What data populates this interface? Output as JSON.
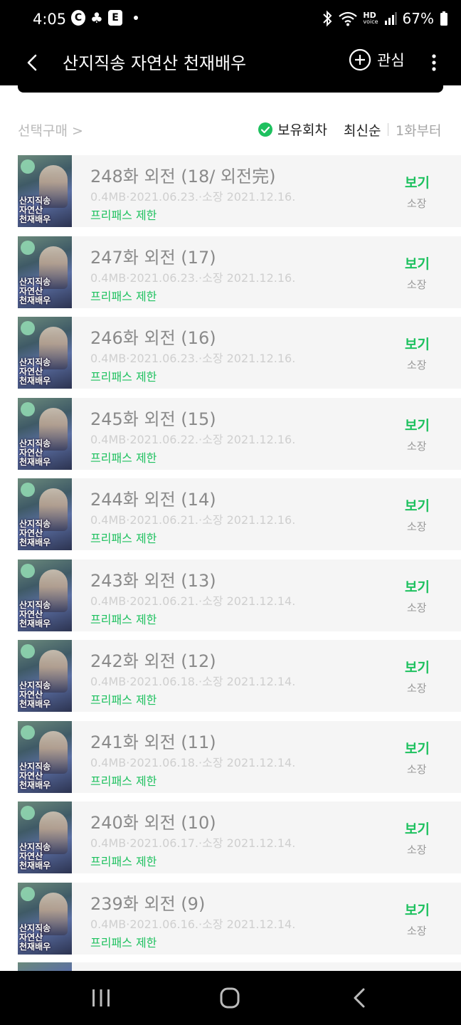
{
  "status_bar": {
    "time": "4:05",
    "notif_icons": [
      "C",
      "♣",
      "E"
    ],
    "icons": [
      "bluetooth-icon",
      "wifi-icon",
      "hd-voice-icon",
      "signal-icon",
      "battery-icon"
    ],
    "hd_label": "HD",
    "voice_label": "voice",
    "battery": "67%"
  },
  "appbar": {
    "title": "산지직송 자연산 천재배우",
    "favorite_label": "관심"
  },
  "filter": {
    "select_buy": "선택구매 >",
    "owned": "보유회차",
    "sort": "최신순",
    "from_first": "1화부터"
  },
  "thumb_text": [
    "산지직송",
    "자연산",
    "천재배우"
  ],
  "episodes": [
    {
      "title": "248화 외전 (18/ 외전完)",
      "meta": "0.4MB·2021.06.23.·소장 2021.12.16.",
      "pass": "프리패스 제한",
      "view": "보기",
      "status": "소장"
    },
    {
      "title": "247화 외전 (17)",
      "meta": "0.4MB·2021.06.23.·소장 2021.12.16.",
      "pass": "프리패스 제한",
      "view": "보기",
      "status": "소장"
    },
    {
      "title": "246화 외전 (16)",
      "meta": "0.4MB·2021.06.23.·소장 2021.12.16.",
      "pass": "프리패스 제한",
      "view": "보기",
      "status": "소장"
    },
    {
      "title": "245화 외전 (15)",
      "meta": "0.4MB·2021.06.22.·소장 2021.12.16.",
      "pass": "프리패스 제한",
      "view": "보기",
      "status": "소장"
    },
    {
      "title": "244화 외전 (14)",
      "meta": "0.4MB·2021.06.21.·소장 2021.12.16.",
      "pass": "프리패스 제한",
      "view": "보기",
      "status": "소장"
    },
    {
      "title": "243화 외전 (13)",
      "meta": "0.4MB·2021.06.21.·소장 2021.12.14.",
      "pass": "프리패스 제한",
      "view": "보기",
      "status": "소장"
    },
    {
      "title": "242화 외전 (12)",
      "meta": "0.4MB·2021.06.18.·소장 2021.12.14.",
      "pass": "프리패스 제한",
      "view": "보기",
      "status": "소장"
    },
    {
      "title": "241화 외전 (11)",
      "meta": "0.4MB·2021.06.18.·소장 2021.12.14.",
      "pass": "프리패스 제한",
      "view": "보기",
      "status": "소장"
    },
    {
      "title": "240화 외전 (10)",
      "meta": "0.4MB·2021.06.17.·소장 2021.12.14.",
      "pass": "프리패스 제한",
      "view": "보기",
      "status": "소장"
    },
    {
      "title": "239화 외전 (9)",
      "meta": "0.4MB·2021.06.16.·소장 2021.12.14.",
      "pass": "프리패스 제한",
      "view": "보기",
      "status": "소장"
    }
  ],
  "colors": {
    "accent_green": "#1ec15f",
    "header_bg": "#000000",
    "row_bg": "#f5f5f5"
  },
  "navbar": {
    "buttons": [
      "recents-icon",
      "home-icon",
      "back-nav-icon"
    ]
  }
}
